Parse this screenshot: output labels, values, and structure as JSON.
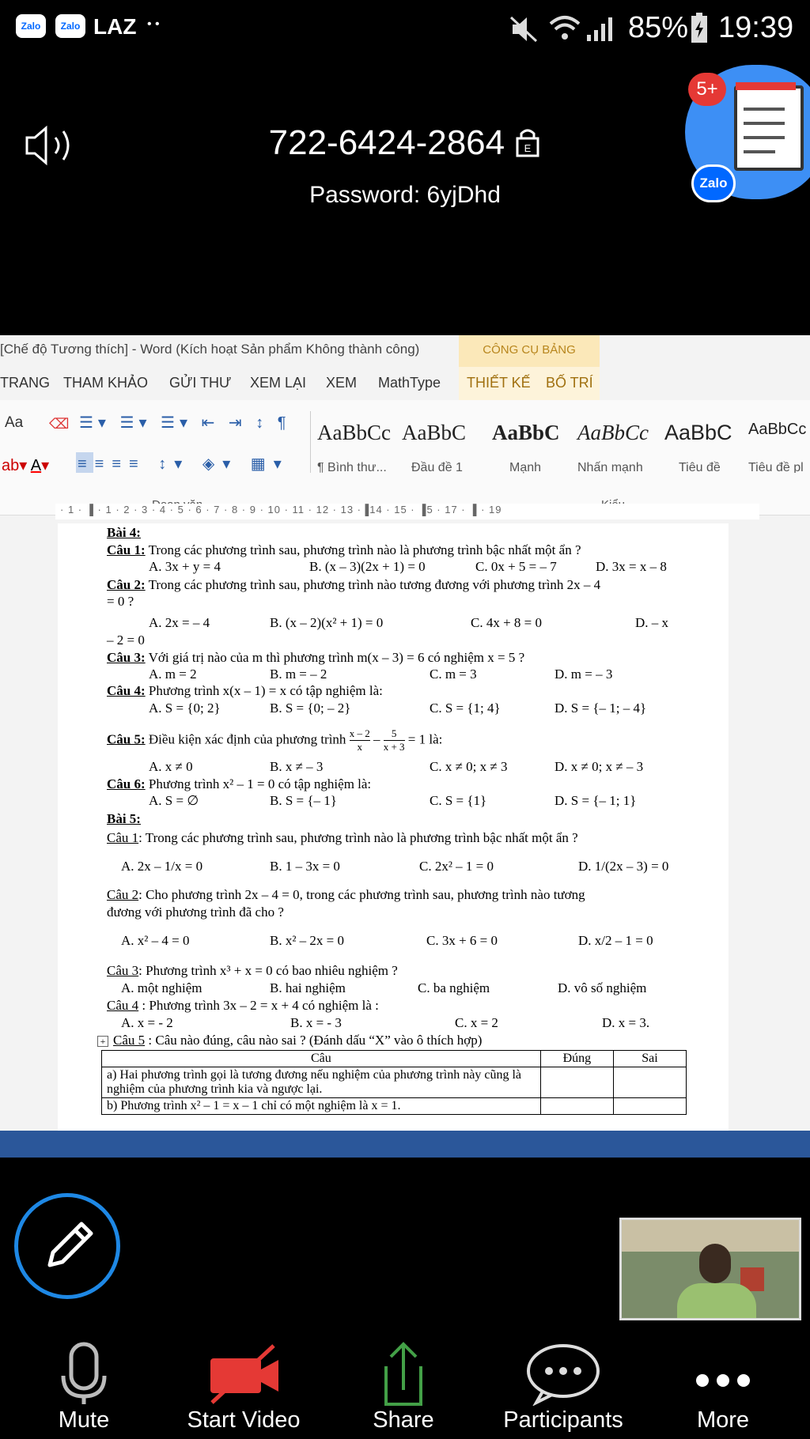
{
  "status_bar": {
    "app_labels": [
      "Zalo",
      "Zalo",
      "LAZ"
    ],
    "dots": "• •",
    "battery": "85%",
    "time": "19:39"
  },
  "meeting": {
    "id": "722-6424-2864",
    "password": "Password: 6yjDhd",
    "notification_badge": "5+",
    "zalo_label": "Zalo"
  },
  "word": {
    "title": "[Chế độ Tương thích] - Word (Kích hoạt Sản phẩm Không thành công)",
    "table_tools": "CÔNG CỤ BẢNG",
    "tabs": [
      "TRANG",
      "THAM KHẢO",
      "GỬI THƯ",
      "XEM LẠI",
      "XEM",
      "MathType",
      "THIẾT KẾ",
      "BỐ TRÍ"
    ],
    "font_size_label": "Aa",
    "paragraph_group": "Đoạn văn",
    "styles_group": "Kiểu",
    "styles": [
      {
        "sample": "AaBbCc",
        "name": "¶ Bình thư..."
      },
      {
        "sample": "AaBbC",
        "name": "Đầu đề 1"
      },
      {
        "sample": "AaBbC",
        "name": "Mạnh"
      },
      {
        "sample": "AaBbCc",
        "name": "Nhấn mạnh"
      },
      {
        "sample": "AaBbC",
        "name": "Tiêu đề"
      },
      {
        "sample": "AaBbCc",
        "name": "Tiêu đề pl"
      }
    ],
    "ruler": "· 1 · ▐ · 1 · 2 · 3 · 4 · 5 · 6 · 7 · 8 · 9 · 10 · 11 · 12 · 13 ·▐14 · 15 · ▐5 · 17 · ▐ · 19",
    "doc": {
      "bai4": "Bài 4:",
      "c1_label": "Câu 1:",
      "c1_text": " Trong các phương trình sau, phương trình nào là phương trình bậc nhất một ẩn ?",
      "c1_opts": [
        "A.  3x + y = 4",
        "B.  (x – 3)(2x + 1) = 0",
        "C.  0x + 5 = – 7",
        "D.  3x = x – 8"
      ],
      "c2_label": "Câu 2:",
      "c2_text": " Trong các phương trình sau, phương trình nào tương đương với phương trình 2x – 4",
      "c2_cont": "= 0 ?",
      "c2_opts": [
        "A.  2x = – 4",
        "B.  (x – 2)(x² + 1) = 0",
        "C.  4x + 8 = 0",
        "D.  – x"
      ],
      "c2_cont2": "– 2 = 0",
      "c3_label": "Câu 3:",
      "c3_text": " Với giá trị nào của m thì phương trình m(x – 3) = 6 có nghiệm x = 5 ?",
      "c3_opts": [
        "A.  m = 2",
        "B.  m = – 2",
        "C.  m = 3",
        "D.  m = – 3"
      ],
      "c4_label": "Câu 4:",
      "c4_text": " Phương trình x(x – 1) = x có tập nghiệm là:",
      "c4_opts": [
        "A.  S = {0; 2}",
        "B.  S = {0; – 2}",
        "C.  S = {1; 4}",
        "D.  S = {– 1; – 4}"
      ],
      "c5_label": "Câu 5:",
      "c5_text": " Điều kiện xác định của phương trình ",
      "c5_frac1_num": "x – 2",
      "c5_frac1_den": "x",
      "c5_frac2_num": "5",
      "c5_frac2_den": "x + 3",
      "c5_tail": " = 1 là:",
      "c5_opts": [
        "A.  x ≠ 0",
        "B.  x ≠ – 3",
        "C.  x ≠ 0; x ≠ 3",
        "D.  x ≠ 0; x ≠ – 3"
      ],
      "c6_label": "Câu 6:",
      "c6_text": " Phương trình x² – 1 = 0 có tập nghiệm là:",
      "c6_opts": [
        "A.  S = ∅",
        "B.  S = {– 1}",
        "C.  S = {1}",
        "D.  S = {– 1; 1}"
      ],
      "bai5": "Bài 5:",
      "b5c1_label": "Câu 1",
      "b5c1_text": ": Trong các phương trình sau, phương trình nào là phương trình bậc nhất một ẩn ?",
      "b5c1_opts": [
        "A. 2x – 1/x = 0",
        "B.  1 – 3x = 0",
        "C. 2x² – 1 = 0",
        "D. 1/(2x – 3) = 0"
      ],
      "b5c2_label": "Câu 2",
      "b5c2_text": ": Cho phương trình 2x – 4 = 0, trong các phương trình sau, phương trình nào tương",
      "b5c2_cont": "đương với phương trình đã cho ?",
      "b5c2_opts": [
        "A. x² – 4 = 0",
        "B. x² – 2x = 0",
        "C. 3x + 6 = 0",
        "D. x/2 – 1 = 0"
      ],
      "b5c3_label": "Câu 3",
      "b5c3_text": ": Phương trình x³ + x = 0 có bao nhiêu nghiệm ?",
      "b5c3_opts": [
        "A. một nghiệm",
        "B. hai nghiệm",
        "C. ba nghiệm",
        "D. vô số nghiệm"
      ],
      "b5c4_label": "Câu 4",
      "b5c4_text": " : Phương trình 3x – 2 = x + 4 có nghiệm là :",
      "b5c4_opts": [
        "A. x = - 2",
        "B. x = - 3",
        "C. x = 2",
        "D. x = 3."
      ],
      "b5c5_label": "Câu 5",
      "b5c5_text": " : Câu nào đúng, câu nào sai ? (Đánh dấu “X” vào ô thích hợp)",
      "table_headers": [
        "Câu",
        "Đúng",
        "Sai"
      ],
      "table_rows": [
        "a) Hai phương trình gọi là tương đương nếu nghiệm của phương trình này cũng là nghiệm của phương trình kia và ngược lại.",
        "b) Phương trình x² – 1 = x – 1 chỉ có một nghiệm là x = 1."
      ]
    }
  },
  "toolbar": {
    "mute": "Mute",
    "start_video": "Start Video",
    "share": "Share",
    "participants": "Participants",
    "more": "More"
  },
  "colors": {
    "word_blue": "#2b579a",
    "pen_ring": "#1e88e5",
    "video_red": "#e53935",
    "share_green": "#43a047"
  }
}
